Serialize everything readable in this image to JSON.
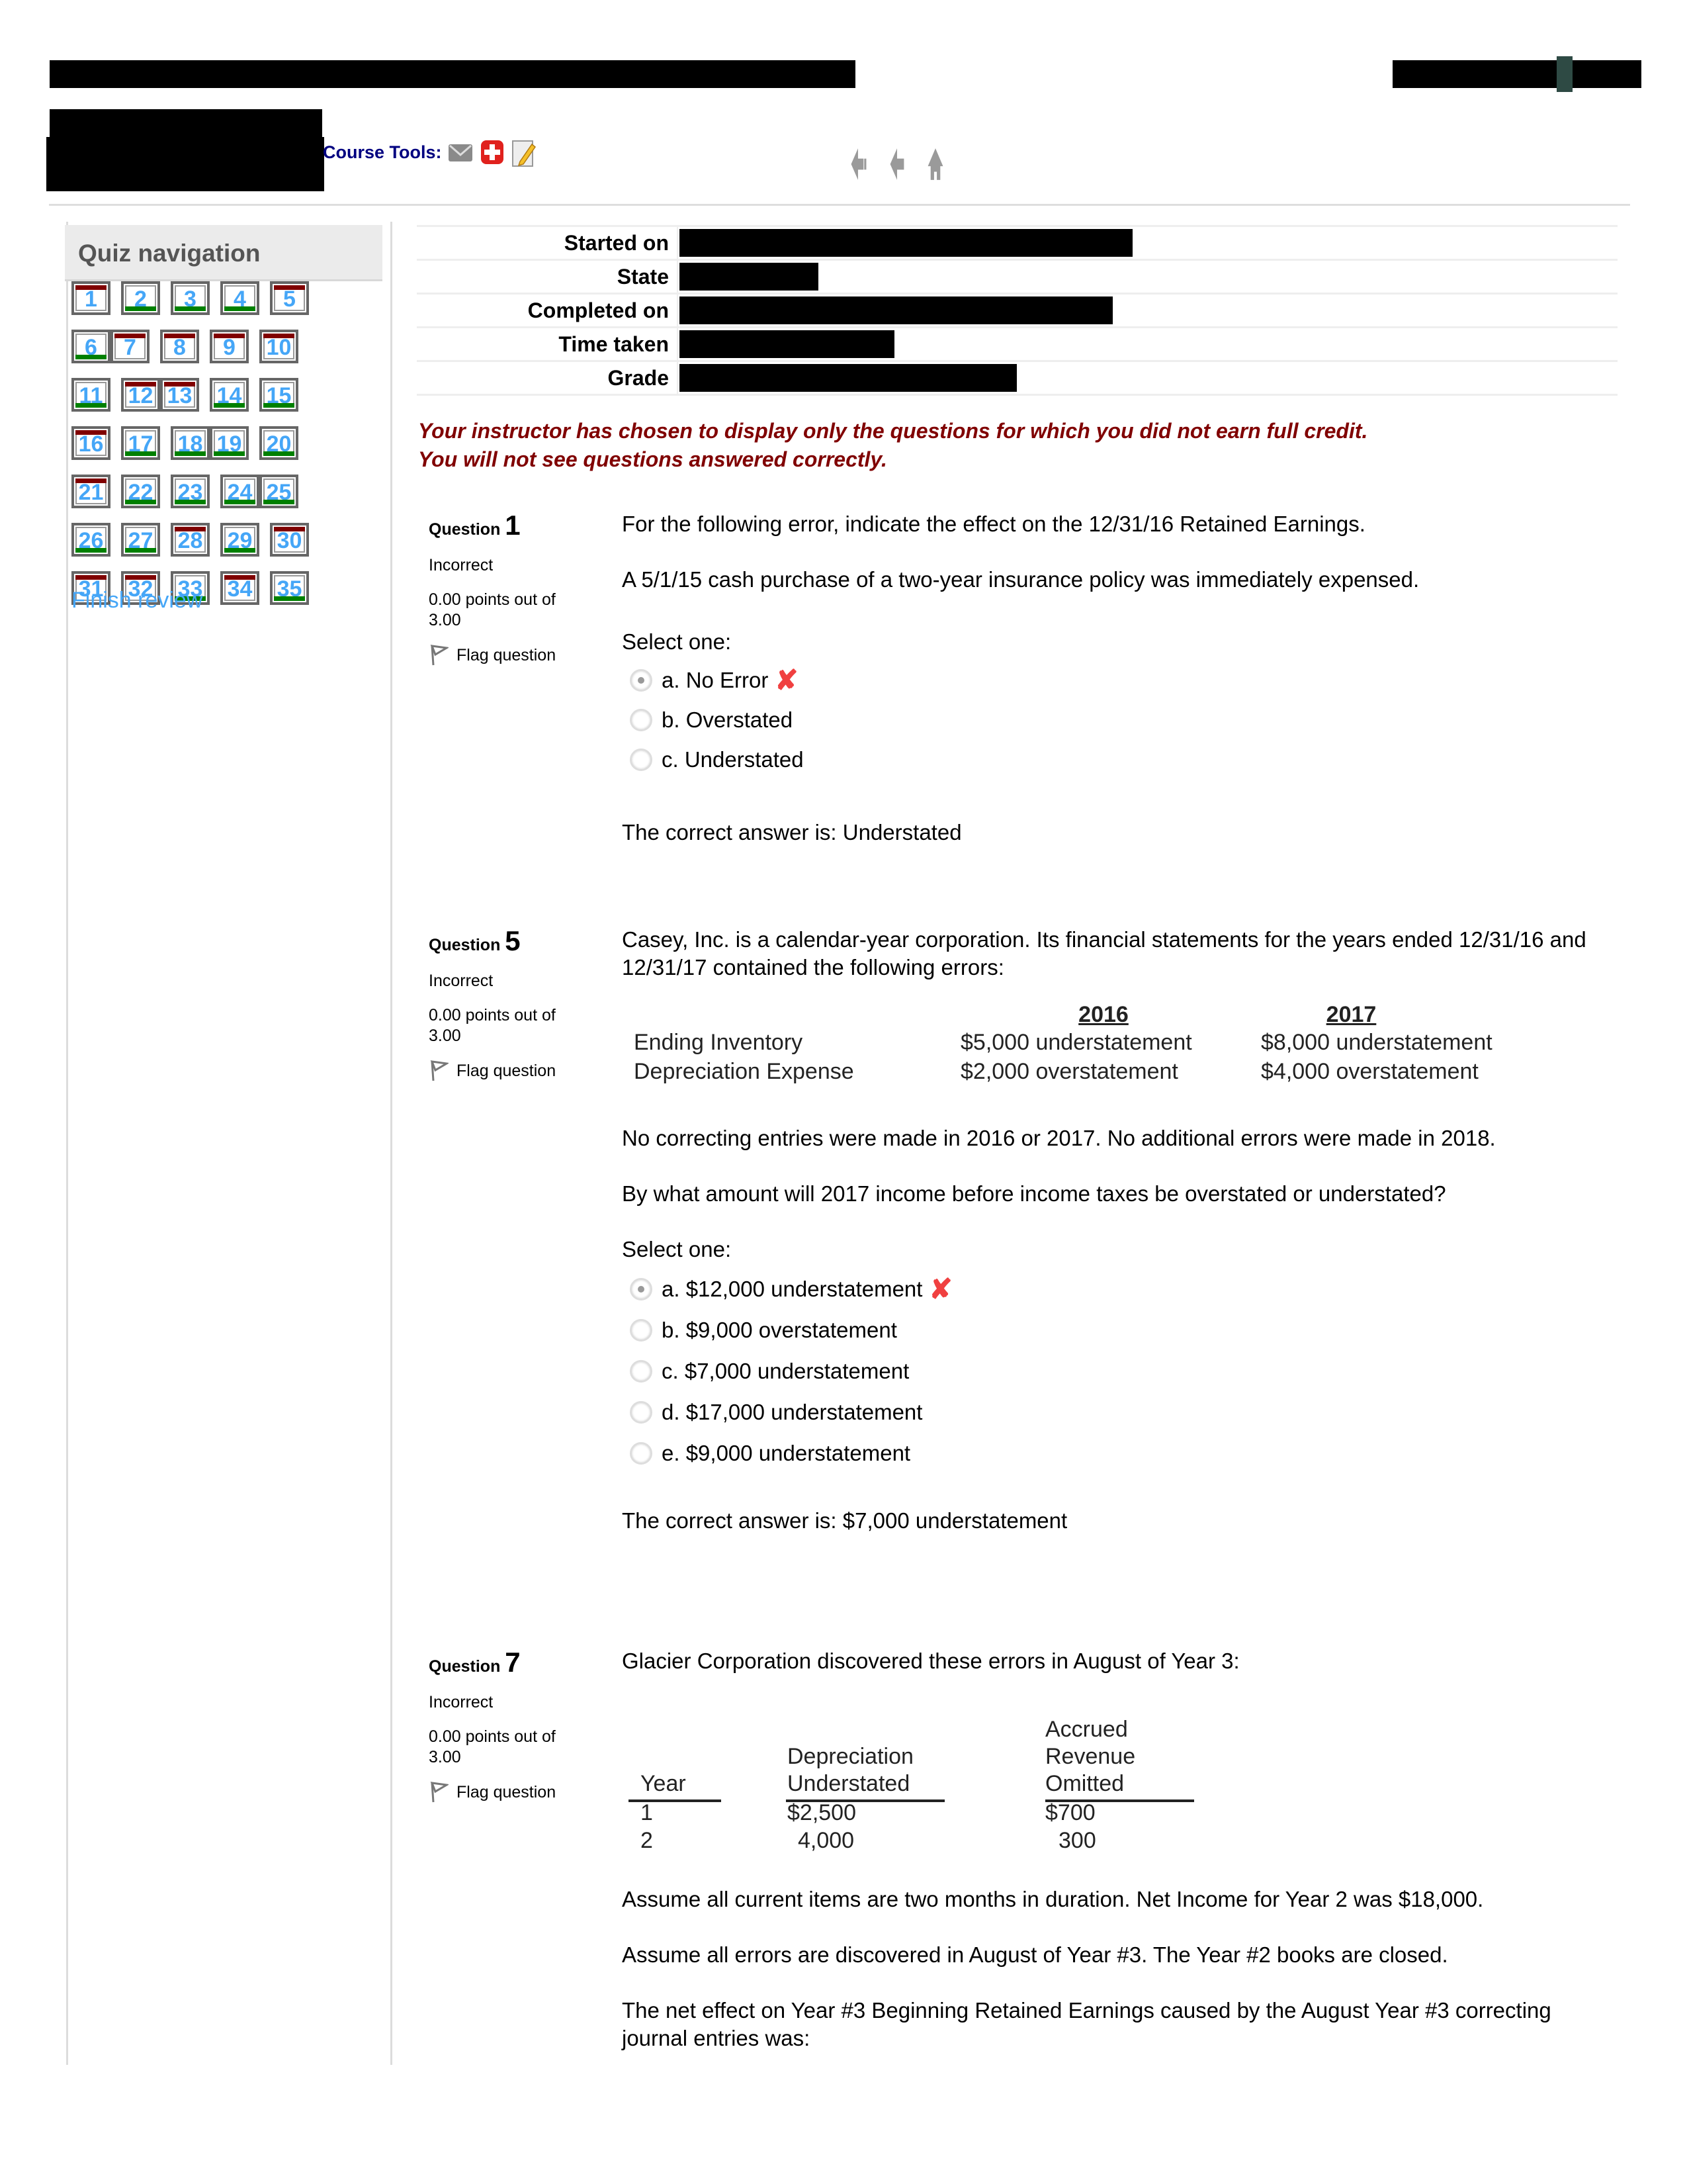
{
  "header": {
    "course_tools_label": "Course Tools:",
    "icons": [
      "mail-icon",
      "help-plus-icon",
      "edit-note-icon"
    ],
    "nav_icons": [
      "back-to-start-icon",
      "back-icon",
      "home-icon"
    ]
  },
  "quiz_nav": {
    "title": "Quiz navigation",
    "finish_review": "Finish review",
    "items": [
      {
        "num": "1",
        "state": "incorrect"
      },
      {
        "num": "2",
        "state": "correct"
      },
      {
        "num": "3",
        "state": "correct"
      },
      {
        "num": "4",
        "state": "correct"
      },
      {
        "num": "5",
        "state": "incorrect"
      },
      {
        "num": "6",
        "state": "correct"
      },
      {
        "num": "7",
        "state": "incorrect"
      },
      {
        "num": "8",
        "state": "incorrect"
      },
      {
        "num": "9",
        "state": "incorrect"
      },
      {
        "num": "10",
        "state": "incorrect"
      },
      {
        "num": "11",
        "state": "correct"
      },
      {
        "num": "12",
        "state": "incorrect"
      },
      {
        "num": "13",
        "state": "incorrect"
      },
      {
        "num": "14",
        "state": "correct"
      },
      {
        "num": "15",
        "state": "correct"
      },
      {
        "num": "16",
        "state": "incorrect"
      },
      {
        "num": "17",
        "state": "correct"
      },
      {
        "num": "18",
        "state": "correct"
      },
      {
        "num": "19",
        "state": "correct"
      },
      {
        "num": "20",
        "state": "correct"
      },
      {
        "num": "21",
        "state": "incorrect"
      },
      {
        "num": "22",
        "state": "correct"
      },
      {
        "num": "23",
        "state": "correct"
      },
      {
        "num": "24",
        "state": "correct"
      },
      {
        "num": "25",
        "state": "correct"
      },
      {
        "num": "26",
        "state": "correct"
      },
      {
        "num": "27",
        "state": "correct"
      },
      {
        "num": "28",
        "state": "incorrect"
      },
      {
        "num": "29",
        "state": "correct"
      },
      {
        "num": "30",
        "state": "incorrect"
      },
      {
        "num": "31",
        "state": "incorrect"
      },
      {
        "num": "32",
        "state": "incorrect"
      },
      {
        "num": "33",
        "state": "correct"
      },
      {
        "num": "34",
        "state": "incorrect"
      },
      {
        "num": "35",
        "state": "correct"
      }
    ]
  },
  "summary": {
    "rows": [
      {
        "label": "Started on",
        "value": "[redacted]"
      },
      {
        "label": "State",
        "value": "[redacted]"
      },
      {
        "label": "Completed on",
        "value": "[redacted]"
      },
      {
        "label": "Time taken",
        "value": "[redacted]"
      },
      {
        "label": "Grade",
        "value": "[redacted]"
      }
    ]
  },
  "notice": {
    "line1": "Your instructor has chosen to display only the questions for which you did not earn full credit.",
    "line2": "You will not see questions answered correctly."
  },
  "colors": {
    "incorrect_bar": "#800000",
    "correct_bar": "#008000",
    "link": "#45a6f7",
    "notice": "#800000",
    "course_tools": "#000080",
    "wrong_mark": "#f04040"
  },
  "questions": [
    {
      "label": "Question",
      "number": "1",
      "state": "Incorrect",
      "grade_line1": "0.00 points out of",
      "grade_line2": "3.00",
      "flag": "Flag question",
      "text": "For the following error, indicate the effect on the 12/31/16 Retained Earnings.",
      "subtext": "A 5/1/15 cash purchase of a two-year insurance policy was immediately expensed.",
      "select_one": "Select one:",
      "answers": [
        {
          "label": "a. No Error",
          "selected": true,
          "marked_wrong": true
        },
        {
          "label": "b. Overstated",
          "selected": false
        },
        {
          "label": "c. Understated",
          "selected": false
        }
      ],
      "correct_answer": "The correct answer is: Understated"
    },
    {
      "label": "Question",
      "number": "5",
      "state": "Incorrect",
      "grade_line1": "0.00 points out of",
      "grade_line2": "3.00",
      "flag": "Flag question",
      "text": "Casey, Inc. is a calendar-year corporation. Its financial statements for the years ended 12/31/16 and 12/31/17 contained the following errors:",
      "table": {
        "headers": [
          "",
          "2016",
          "2017"
        ],
        "rows": [
          [
            "Ending Inventory",
            "$5,000 understatement",
            "$8,000 understatement"
          ],
          [
            "Depreciation Expense",
            "$2,000 overstatement",
            "$4,000 overstatement"
          ]
        ]
      },
      "para1": "No correcting entries were made in 2016 or 2017. No additional errors were made in 2018.",
      "para2": "By what amount will 2017 income before income taxes be overstated or understated?",
      "select_one": "Select one:",
      "answers": [
        {
          "label": "a. $12,000 understatement",
          "selected": true,
          "marked_wrong": true
        },
        {
          "label": "b. $9,000 overstatement",
          "selected": false
        },
        {
          "label": "c. $7,000 understatement",
          "selected": false
        },
        {
          "label": "d. $17,000 understatement",
          "selected": false
        },
        {
          "label": "e. $9,000 understatement",
          "selected": false
        }
      ],
      "correct_answer": "The correct answer is: $7,000 understatement"
    },
    {
      "label": "Question",
      "number": "7",
      "state": "Incorrect",
      "grade_line1": "0.00 points out of",
      "grade_line2": "3.00",
      "flag": "Flag question",
      "text": "Glacier Corporation discovered these errors in August of Year 3:",
      "table": {
        "headers": [
          "Year",
          "Depreciation\nUnderstated",
          "Accrued\nRevenue\nOmitted"
        ],
        "head_lines": [
          [
            "Year"
          ],
          [
            "Depreciation",
            "Understated"
          ],
          [
            "Accrued",
            "Revenue",
            "Omitted"
          ]
        ],
        "rows": [
          [
            "1",
            "$2,500",
            "$700"
          ],
          [
            "2",
            "4,000",
            "300"
          ]
        ]
      },
      "para1": "Assume all current items are two months in duration. Net Income for Year 2 was $18,000.",
      "para2": "Assume all errors are discovered in August of Year #3. The Year #2 books are closed.",
      "para3": "The net effect on Year #3 Beginning Retained Earnings caused by the August Year #3 correcting journal entries was:"
    }
  ]
}
